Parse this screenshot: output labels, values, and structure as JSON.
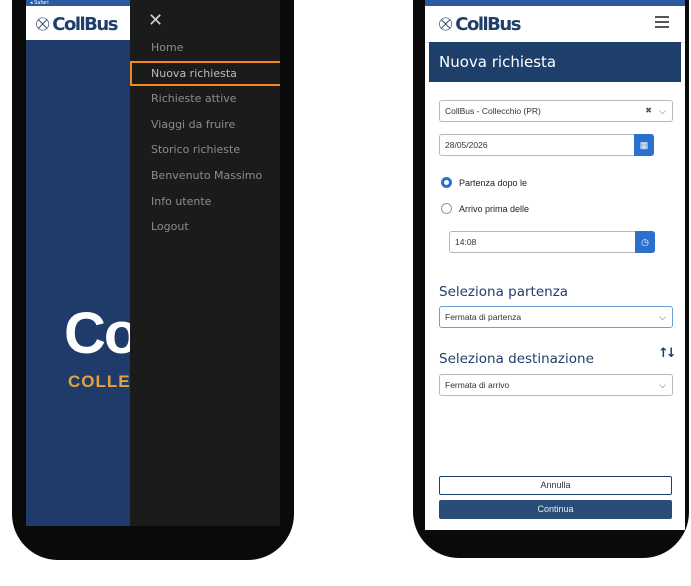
{
  "left": {
    "status_text": "◂ Safari",
    "logo_text": "CollBus",
    "big_text": "Co",
    "big_subtext": "COLLEC",
    "close_symbol": "✕",
    "menu": [
      {
        "label": "Home",
        "active": false
      },
      {
        "label": "Nuova richiesta",
        "active": true
      },
      {
        "label": "Richieste attive",
        "active": false
      },
      {
        "label": "Viaggi da fruire",
        "active": false
      },
      {
        "label": "Storico richieste",
        "active": false
      },
      {
        "label": "Benvenuto Massimo",
        "active": false
      },
      {
        "label": "Info utente",
        "active": false
      },
      {
        "label": "Logout",
        "active": false
      }
    ]
  },
  "right": {
    "logo_text": "CollBus",
    "page_title": "Nuova richiesta",
    "service_select": "CollBus - Collecchio (PR)",
    "date_value": "28/05/2026",
    "radio_options": [
      {
        "label": "Partenza dopo le",
        "checked": true
      },
      {
        "label": "Arrivo prima delle",
        "checked": false
      }
    ],
    "time_value": "14:08",
    "departure_title": "Seleziona partenza",
    "departure_placeholder": "Fermata di partenza",
    "destination_title": "Seleziona destinazione",
    "destination_placeholder": "Fermata di arrivo",
    "cancel_label": "Annulla",
    "continue_label": "Continua"
  },
  "colors": {
    "brand_navy": "#1f3f6b",
    "accent_blue": "#2b6fcf",
    "highlight_orange": "#f08a1e",
    "drawer_bg": "#1b1b1b"
  },
  "icons": {
    "logo": "bus-pin-icon",
    "close": "close-icon",
    "menu": "hamburger-icon",
    "calendar": "calendar-icon",
    "clock": "clock-icon",
    "swap": "swap-vertical-icon"
  }
}
